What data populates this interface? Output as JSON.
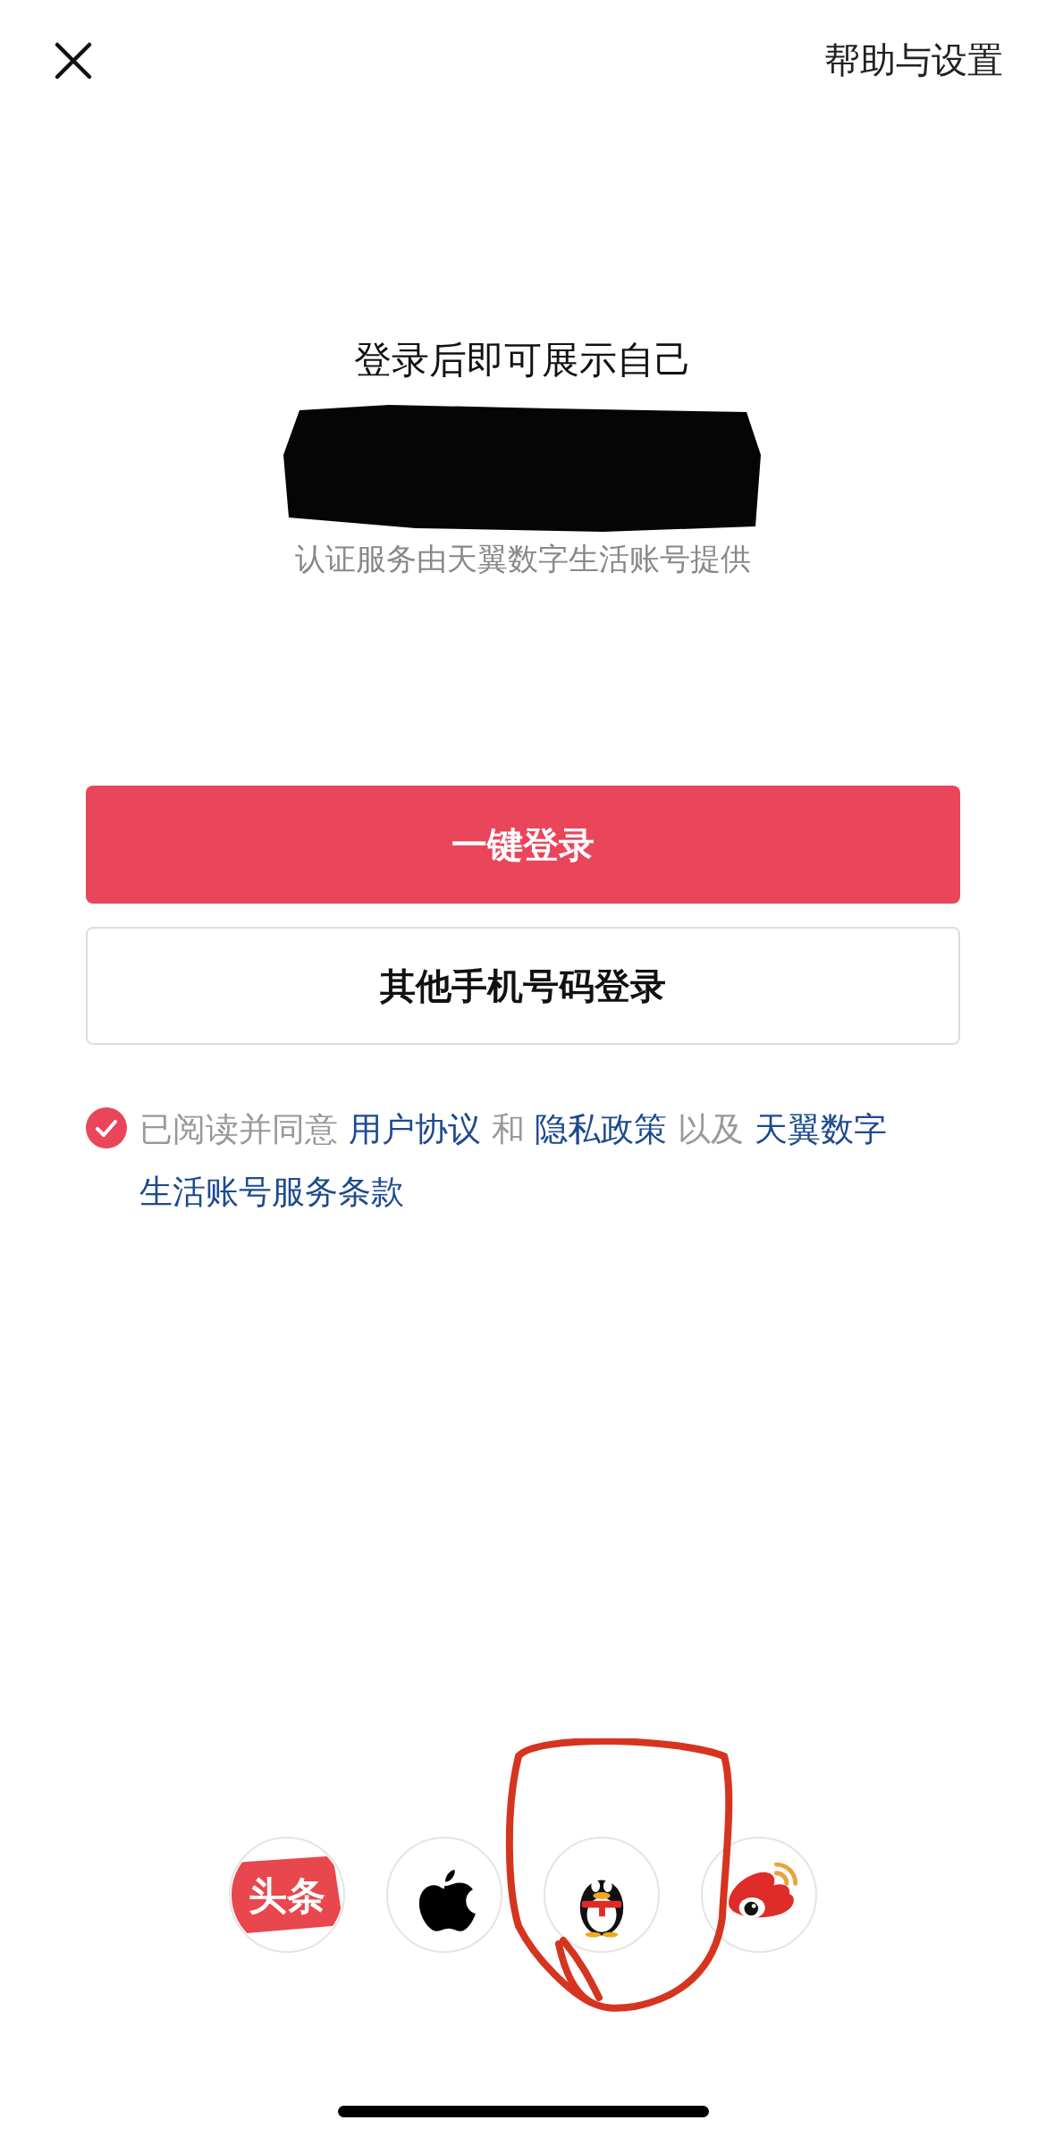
{
  "header": {
    "help": "帮助与设置"
  },
  "title": "登录后即可展示自己",
  "subtitle": "认证服务由天翼数字生活账号提供",
  "buttons": [
    {
      "label": "一键登录",
      "kind": "primary"
    },
    {
      "label": "其他手机号码登录",
      "kind": "secondary"
    }
  ],
  "agreement": {
    "checked": true,
    "parts": [
      {
        "text": "已阅读并同意 ",
        "link": false
      },
      {
        "text": "用户协议",
        "link": true
      },
      {
        "text": " 和 ",
        "link": false
      },
      {
        "text": "隐私政策",
        "link": true
      },
      {
        "text": " 以及 ",
        "link": false
      },
      {
        "text": "天翼数字",
        "link": true
      },
      {
        "text": "生活账号服务条款",
        "link": true
      }
    ]
  },
  "social_logins": [
    {
      "kind": "toutiao",
      "label": "头条"
    },
    {
      "kind": "apple"
    },
    {
      "kind": "qq"
    },
    {
      "kind": "weibo"
    }
  ]
}
